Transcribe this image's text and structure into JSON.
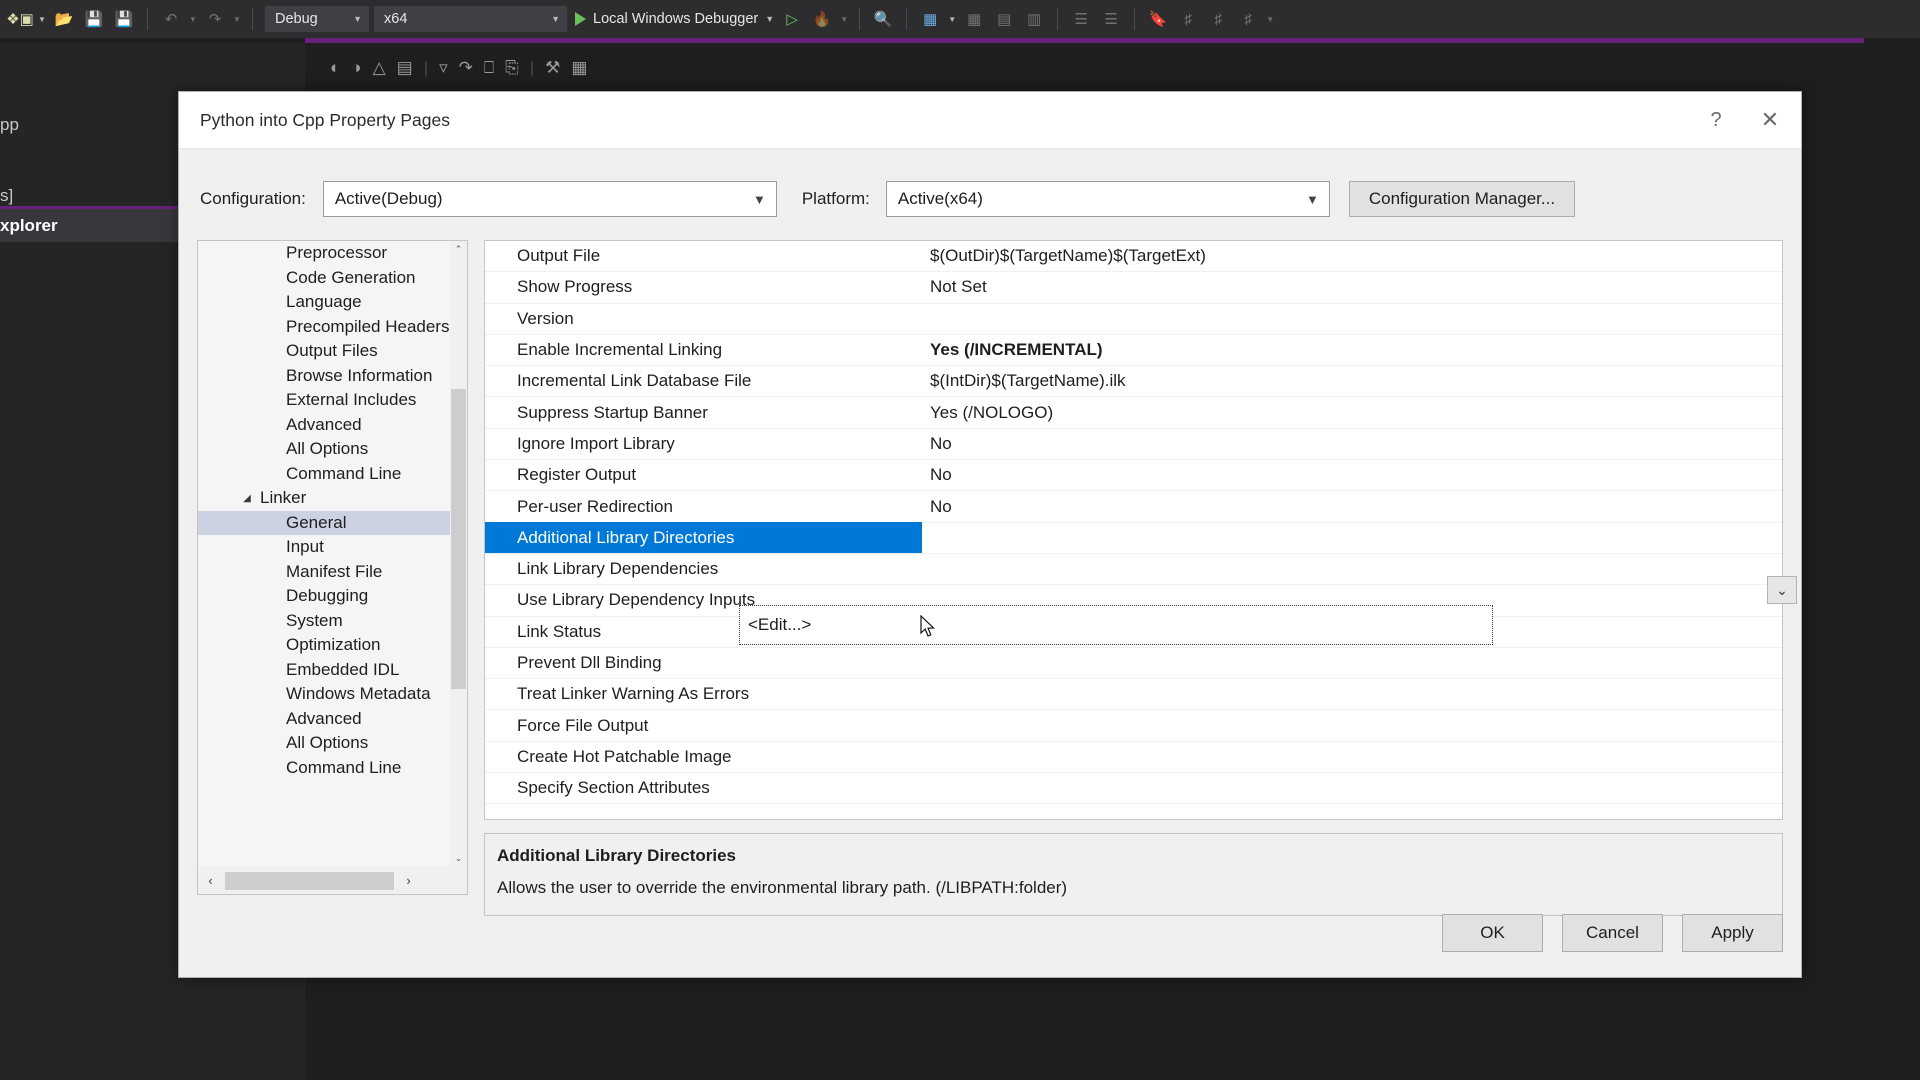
{
  "vs_shell": {
    "toolbar": {
      "new_project_label": "new-project",
      "open_label": "open-file",
      "save_label": "save",
      "save_all_label": "save-all",
      "undo_label": "undo",
      "redo_label": "redo",
      "configuration": "Debug",
      "platform": "x64",
      "run_label": "Local Windows Debugger",
      "attach_label": "attach-to-process",
      "hot_reload_label": "hot-reload"
    },
    "background": {
      "text_fragment_1": "pp",
      "text_fragment_2": "s]",
      "text_fragment_3": "xplorer"
    }
  },
  "dialog": {
    "title": "Python into Cpp Property Pages",
    "help_glyph": "?",
    "close_glyph": "✕",
    "configuration": {
      "label": "Configuration:",
      "value": "Active(Debug)"
    },
    "platform": {
      "label": "Platform:",
      "value": "Active(x64)"
    },
    "config_manager_button": "Configuration Manager...",
    "tree": {
      "items": [
        {
          "label": "Preprocessor",
          "depth": 2,
          "expander": "",
          "selected": false
        },
        {
          "label": "Code Generation",
          "depth": 2,
          "expander": "",
          "selected": false
        },
        {
          "label": "Language",
          "depth": 2,
          "expander": "",
          "selected": false
        },
        {
          "label": "Precompiled Headers",
          "depth": 2,
          "expander": "",
          "selected": false
        },
        {
          "label": "Output Files",
          "depth": 2,
          "expander": "",
          "selected": false
        },
        {
          "label": "Browse Information",
          "depth": 2,
          "expander": "",
          "selected": false
        },
        {
          "label": "External Includes",
          "depth": 2,
          "expander": "",
          "selected": false
        },
        {
          "label": "Advanced",
          "depth": 2,
          "expander": "",
          "selected": false
        },
        {
          "label": "All Options",
          "depth": 2,
          "expander": "",
          "selected": false
        },
        {
          "label": "Command Line",
          "depth": 2,
          "expander": "",
          "selected": false
        },
        {
          "label": "Linker",
          "depth": 1,
          "expander": "◢",
          "selected": false
        },
        {
          "label": "General",
          "depth": 2,
          "expander": "",
          "selected": true
        },
        {
          "label": "Input",
          "depth": 2,
          "expander": "",
          "selected": false
        },
        {
          "label": "Manifest File",
          "depth": 2,
          "expander": "",
          "selected": false
        },
        {
          "label": "Debugging",
          "depth": 2,
          "expander": "",
          "selected": false
        },
        {
          "label": "System",
          "depth": 2,
          "expander": "",
          "selected": false
        },
        {
          "label": "Optimization",
          "depth": 2,
          "expander": "",
          "selected": false
        },
        {
          "label": "Embedded IDL",
          "depth": 2,
          "expander": "",
          "selected": false
        },
        {
          "label": "Windows Metadata",
          "depth": 2,
          "expander": "",
          "selected": false
        },
        {
          "label": "Advanced",
          "depth": 2,
          "expander": "",
          "selected": false
        },
        {
          "label": "All Options",
          "depth": 2,
          "expander": "",
          "selected": false
        },
        {
          "label": "Command Line",
          "depth": 2,
          "expander": "",
          "selected": false
        }
      ],
      "scroll_up_glyph": "⌃",
      "scroll_down_glyph": "⌄",
      "scroll_left_glyph": "‹",
      "scroll_right_glyph": "›"
    },
    "properties": [
      {
        "name": "Output File",
        "value": "$(OutDir)$(TargetName)$(TargetExt)",
        "bold": false,
        "selected": false
      },
      {
        "name": "Show Progress",
        "value": "Not Set",
        "bold": false,
        "selected": false
      },
      {
        "name": "Version",
        "value": "",
        "bold": false,
        "selected": false
      },
      {
        "name": "Enable Incremental Linking",
        "value": "Yes (/INCREMENTAL)",
        "bold": true,
        "selected": false
      },
      {
        "name": "Incremental Link Database File",
        "value": "$(IntDir)$(TargetName).ilk",
        "bold": false,
        "selected": false
      },
      {
        "name": "Suppress Startup Banner",
        "value": "Yes (/NOLOGO)",
        "bold": false,
        "selected": false
      },
      {
        "name": "Ignore Import Library",
        "value": "No",
        "bold": false,
        "selected": false
      },
      {
        "name": "Register Output",
        "value": "No",
        "bold": false,
        "selected": false
      },
      {
        "name": "Per-user Redirection",
        "value": "No",
        "bold": false,
        "selected": false
      },
      {
        "name": "Additional Library Directories",
        "value": "",
        "bold": false,
        "selected": true
      },
      {
        "name": "Link Library Dependencies",
        "value": "",
        "bold": false,
        "selected": false
      },
      {
        "name": "Use Library Dependency Inputs",
        "value": "",
        "bold": false,
        "selected": false
      },
      {
        "name": "Link Status",
        "value": "",
        "bold": false,
        "selected": false
      },
      {
        "name": "Prevent Dll Binding",
        "value": "",
        "bold": false,
        "selected": false
      },
      {
        "name": "Treat Linker Warning As Errors",
        "value": "",
        "bold": false,
        "selected": false
      },
      {
        "name": "Force File Output",
        "value": "",
        "bold": false,
        "selected": false
      },
      {
        "name": "Create Hot Patchable Image",
        "value": "",
        "bold": false,
        "selected": false
      },
      {
        "name": "Specify Section Attributes",
        "value": "",
        "bold": false,
        "selected": false
      }
    ],
    "editor": {
      "dropdown_option": "<Edit...>",
      "chevron_glyph": "⌄"
    },
    "description": {
      "title": "Additional Library Directories",
      "text": "Allows the user to override the environmental library path. (/LIBPATH:folder)"
    },
    "footer": {
      "ok": "OK",
      "cancel": "Cancel",
      "apply": "Apply"
    }
  }
}
